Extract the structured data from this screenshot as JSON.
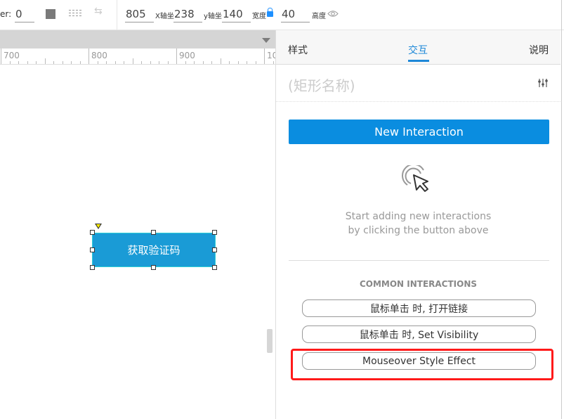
{
  "toolbar": {
    "border_label": "er:",
    "border_value": "0",
    "width_value": "805",
    "x_label": "X轴坐",
    "x_value": "238",
    "y_label": "y轴坐",
    "y_value": "140",
    "width_label": "宽度",
    "height_value": "40",
    "height_label": "高度",
    "icons": [
      "fill-swatch-icon",
      "line-style-icon",
      "arrow-swap-icon",
      "lock-icon",
      "eye-icon"
    ]
  },
  "canvas": {
    "ruler_labels": [
      "700",
      "800",
      "900",
      "10"
    ],
    "widget_label": "获取验证码",
    "widget_color": "#1a9bd6"
  },
  "panel": {
    "tabs": [
      {
        "label": "样式",
        "active": false
      },
      {
        "label": "交互",
        "active": true
      },
      {
        "label": "说明",
        "active": false
      }
    ],
    "name_placeholder": "(矩形名称)",
    "new_interaction_label": "New Interaction",
    "hint_line1": "Start adding new interactions",
    "hint_line2": "by clicking the button above",
    "common_title": "COMMON INTERACTIONS",
    "common_items": [
      "鼠标单击 时, 打开链接",
      "鼠标单击 时, Set Visibility",
      "Mouseover Style Effect"
    ],
    "accent_color": "#0a8de0",
    "highlight_color": "#ff1a1a"
  }
}
